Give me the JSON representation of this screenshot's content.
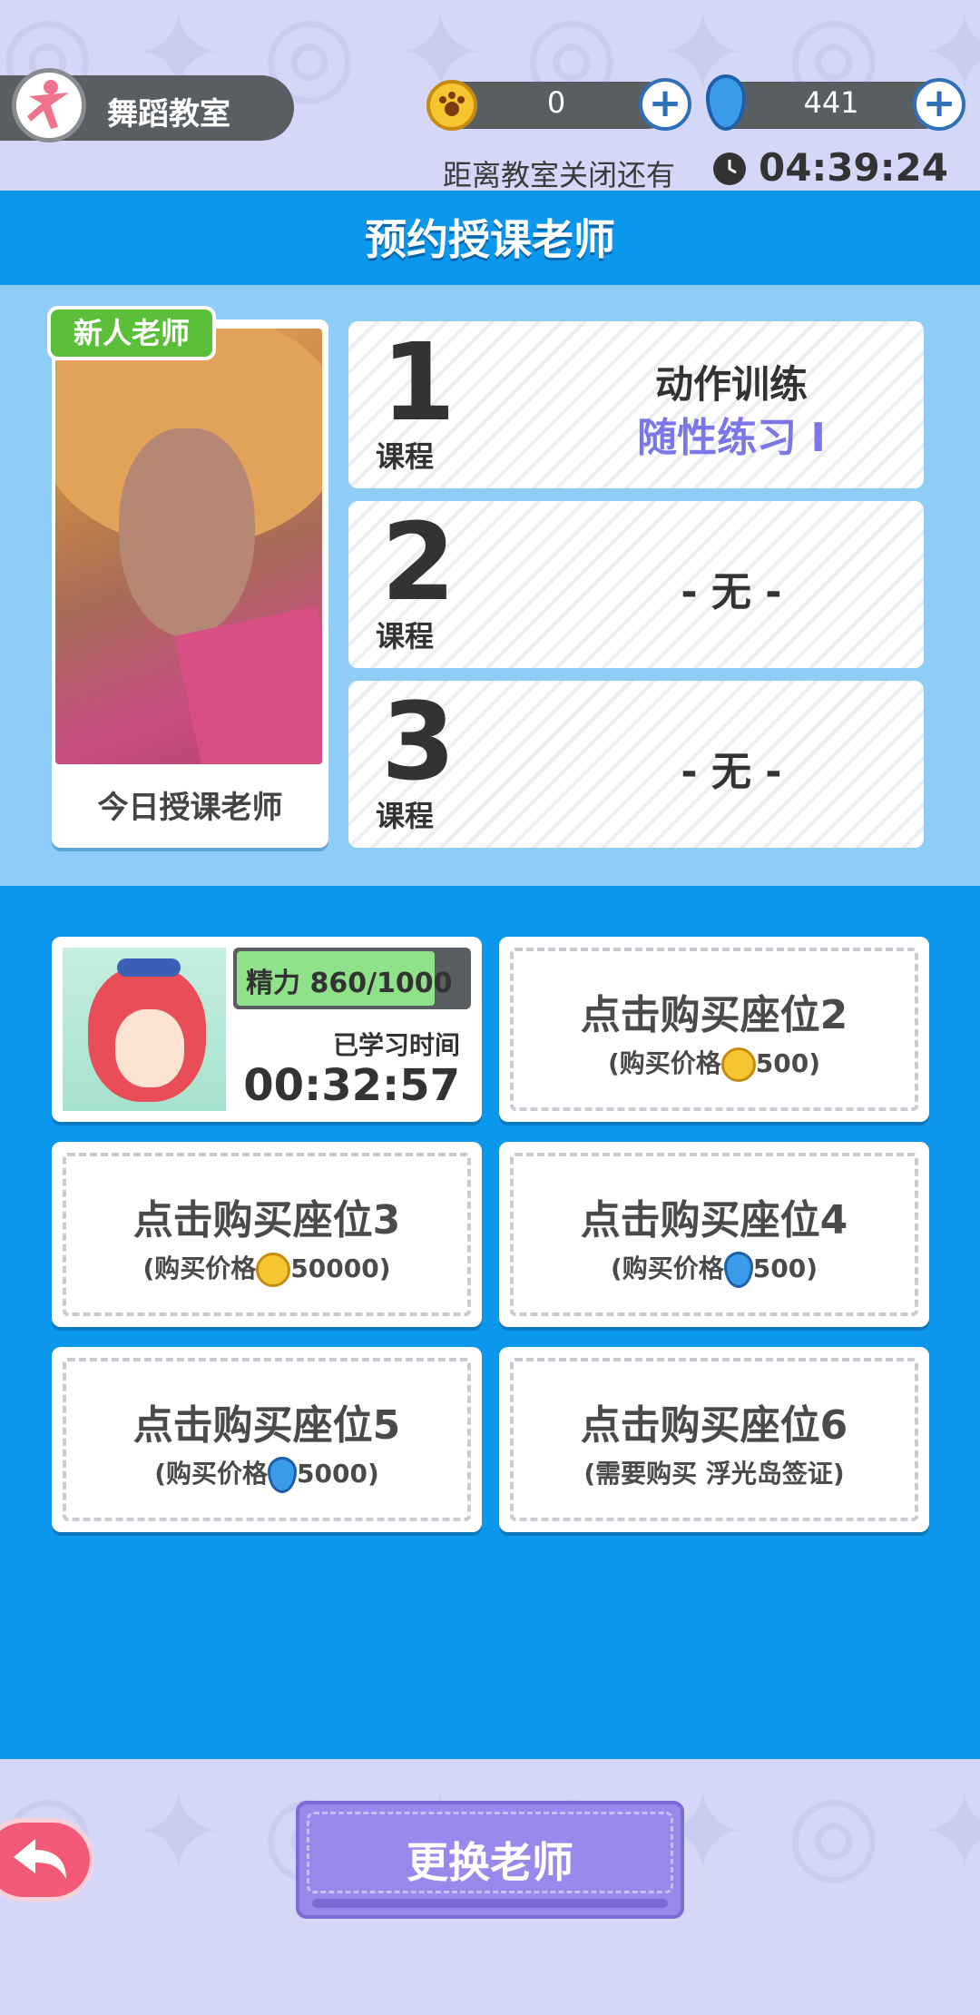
{
  "header": {
    "location_label": "舞蹈教室",
    "coins": "0",
    "gems": "441",
    "timer_label": "距离教室关闭还有",
    "timer_value": "04:39:24"
  },
  "reserve": {
    "title": "预约授课老师",
    "badge": "新人老师",
    "caption": "今日授课老师",
    "course_label": "课程",
    "courses": [
      {
        "number": "1",
        "line1": "动作训练",
        "line2": "随性练习 I"
      },
      {
        "number": "2",
        "line1": "- 无 -"
      },
      {
        "number": "3",
        "line1": "- 无 -"
      }
    ]
  },
  "seats": {
    "student": {
      "energy_text": "精力  860/1000",
      "energy_fraction": 0.86,
      "studied_label": "已学习时间",
      "studied_value": "00:32:57"
    },
    "seat2": {
      "title": "点击购买座位2",
      "price_open": "(购买价格",
      "price_value": "500)"
    },
    "seat3": {
      "title": "点击购买座位3",
      "price_open": "(购买价格",
      "price_value": "50000)"
    },
    "seat4": {
      "title": "点击购买座位4",
      "price_open": "(购买价格",
      "price_value": "500)"
    },
    "seat5": {
      "title": "点击购买座位5",
      "price_open": "(购买价格",
      "price_value": "5000)"
    },
    "seat6": {
      "title": "点击购买座位6",
      "price_full": "(需要购买 浮光岛签证)"
    }
  },
  "footer": {
    "change_teacher": "更换老师"
  },
  "colors": {
    "accent_blue": "#0b98ec",
    "light_blue": "#8ecdf8",
    "background": "#d4d7f7",
    "button_purple": "#9989ec",
    "badge_green": "#5cbf3a"
  },
  "icons": [
    "dance-icon",
    "paw-coin-icon",
    "gem-icon",
    "plus-icon",
    "clock-icon",
    "back-arrow-icon"
  ]
}
